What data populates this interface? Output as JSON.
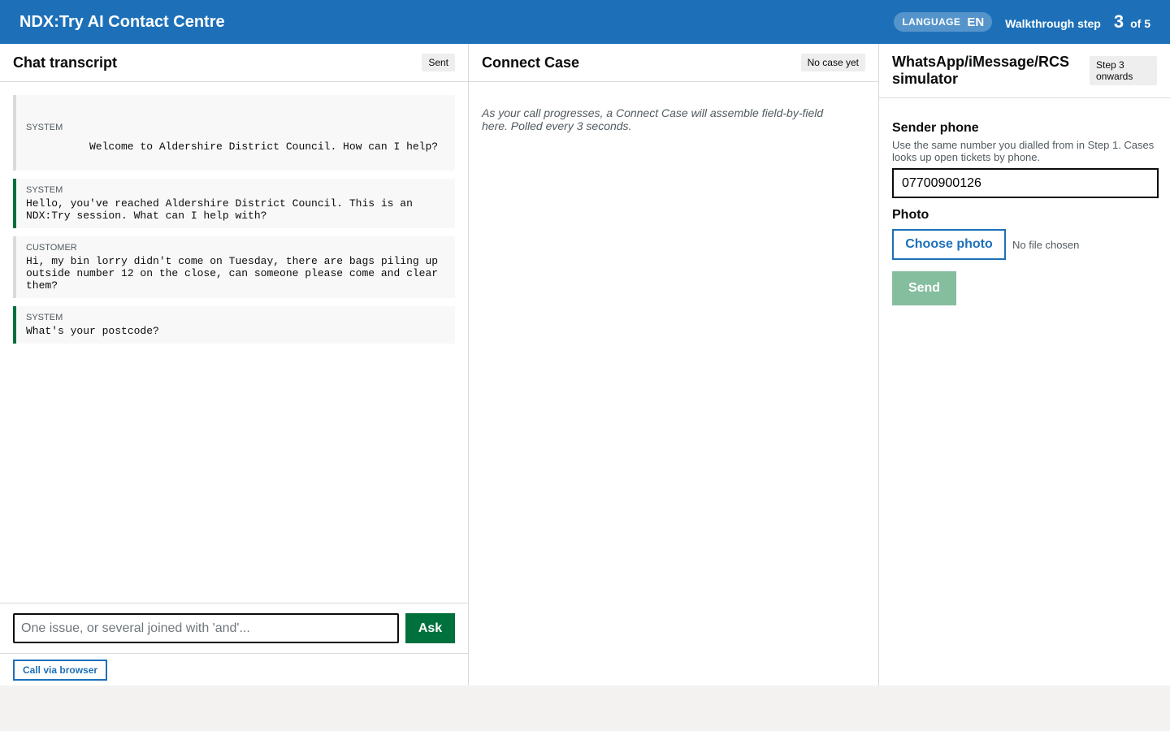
{
  "header": {
    "title": "NDX:Try AI Contact Centre",
    "language_label": "LANGUAGE",
    "language_code": "EN",
    "walkthrough_label": "Walkthrough step",
    "walkthrough_step": "3",
    "walkthrough_total": "of 5"
  },
  "chat": {
    "title": "Chat transcript",
    "status_badge": "Sent",
    "messages": [
      {
        "role": "SYSTEM",
        "text": "Welcome to Aldershire District Council. How can I help?"
      },
      {
        "role": "SYSTEM",
        "text": "Hello, you've reached Aldershire District Council. This is an NDX:Try session. What can I help with?"
      },
      {
        "role": "CUSTOMER",
        "text": "Hi, my bin lorry didn't come on Tuesday, there are bags piling up outside number 12 on the close, can someone please come and clear them?"
      },
      {
        "role": "SYSTEM",
        "text": "What's your postcode?"
      }
    ],
    "input_placeholder": "One issue, or several joined with 'and'...",
    "ask_label": "Ask",
    "call_label": "Call via browser"
  },
  "case": {
    "title": "Connect Case",
    "status_badge": "No case yet",
    "placeholder": "As your call progresses, a Connect Case will assemble field-by-field here. Polled every 3 seconds."
  },
  "simulator": {
    "title": "WhatsApp/iMessage/RCS simulator",
    "step_badge": "Step 3 onwards",
    "sender_label": "Sender phone",
    "sender_hint": "Use the same number you dialled from in Step 1. Cases looks up open tickets by phone.",
    "sender_value": "07700900126",
    "photo_label": "Photo",
    "choose_photo_label": "Choose photo",
    "file_status": "No file chosen",
    "send_label": "Send"
  }
}
